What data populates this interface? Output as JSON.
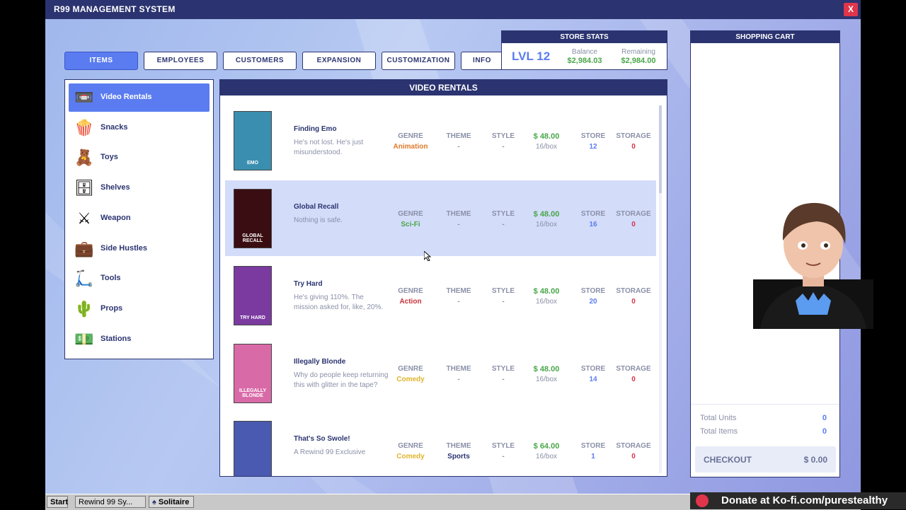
{
  "window": {
    "title": "R99 MANAGEMENT SYSTEM",
    "close_label": "X"
  },
  "tabs": [
    {
      "label": "ITEMS"
    },
    {
      "label": "EMPLOYEES"
    },
    {
      "label": "CUSTOMERS"
    },
    {
      "label": "EXPANSION"
    },
    {
      "label": "CUSTOMIZATION"
    },
    {
      "label": "INFO"
    }
  ],
  "store_stats": {
    "header": "STORE STATS",
    "level": "LVL 12",
    "balance_label": "Balance",
    "balance": "$2,984.03",
    "remaining_label": "Remaining",
    "remaining": "$2,984.00"
  },
  "categories": [
    {
      "label": "Video Rentals",
      "icon": "vhs-tape-icon"
    },
    {
      "label": "Snacks",
      "icon": "popcorn-icon"
    },
    {
      "label": "Toys",
      "icon": "teddy-bear-icon"
    },
    {
      "label": "Shelves",
      "icon": "shelf-icon"
    },
    {
      "label": "Weapon",
      "icon": "crossed-bats-icon"
    },
    {
      "label": "Side Hustles",
      "icon": "briefcase-icon"
    },
    {
      "label": "Tools",
      "icon": "scooter-icon"
    },
    {
      "label": "Props",
      "icon": "cactus-icon"
    },
    {
      "label": "Stations",
      "icon": "cash-register-icon"
    }
  ],
  "main": {
    "header": "VIDEO RENTALS",
    "col_genre": "GENRE",
    "col_theme": "THEME",
    "col_style": "STYLE",
    "col_store": "STORE",
    "col_storage": "STORAGE",
    "items": [
      {
        "name": "Finding Emo",
        "desc": "He's not lost. He's just misunderstood.",
        "genre": "Animation",
        "genre_color": "#e07a2a",
        "theme": "-",
        "style": "-",
        "price": "$ 48.00",
        "per_box": "16/box",
        "store": "12",
        "storage": "0",
        "cover_text": "EMO",
        "cover_color": "#3a8fb0"
      },
      {
        "name": "Global Recall",
        "desc": "Nothing is safe.",
        "genre": "Sci-Fi",
        "genre_color": "#4aa64a",
        "theme": "-",
        "style": "-",
        "price": "$ 48.00",
        "per_box": "16/box",
        "store": "16",
        "storage": "0",
        "cover_text": "GLOBAL RECALL",
        "cover_color": "#3a0d12"
      },
      {
        "name": "Try Hard",
        "desc": "He's giving 110%. The mission asked for, like, 20%.",
        "genre": "Action",
        "genre_color": "#c8323c",
        "theme": "-",
        "style": "-",
        "price": "$ 48.00",
        "per_box": "16/box",
        "store": "20",
        "storage": "0",
        "cover_text": "TRY HARD",
        "cover_color": "#7a3aa0"
      },
      {
        "name": "Illegally Blonde",
        "desc": "Why do people keep returning this with glitter in the tape?",
        "genre": "Comedy",
        "genre_color": "#e0b42a",
        "theme": "-",
        "style": "-",
        "price": "$ 48.00",
        "per_box": "16/box",
        "store": "14",
        "storage": "0",
        "cover_text": "ILLEGALLY BLONDE",
        "cover_color": "#d96aa8"
      },
      {
        "name": "That's So Swole!",
        "desc": "A Rewind 99 Exclusive",
        "genre": "Comedy",
        "genre_color": "#e0b42a",
        "theme": "Sports",
        "style": "-",
        "price": "$ 64.00",
        "per_box": "16/box",
        "store": "1",
        "storage": "0",
        "cover_text": "",
        "cover_color": "#4a5ab0"
      }
    ]
  },
  "cart": {
    "header": "SHOPPING CART",
    "total_units_label": "Total Units",
    "total_units": "0",
    "total_items_label": "Total Items",
    "total_items": "0",
    "checkout_label": "CHECKOUT",
    "checkout_value": "$ 0.00"
  },
  "taskbar": {
    "start": "Start",
    "task1": "Rewind 99 Sy...",
    "task2": "Solitaire"
  },
  "overlay": {
    "kofi": "Donate at Ko-fi.com/purestealthy"
  }
}
